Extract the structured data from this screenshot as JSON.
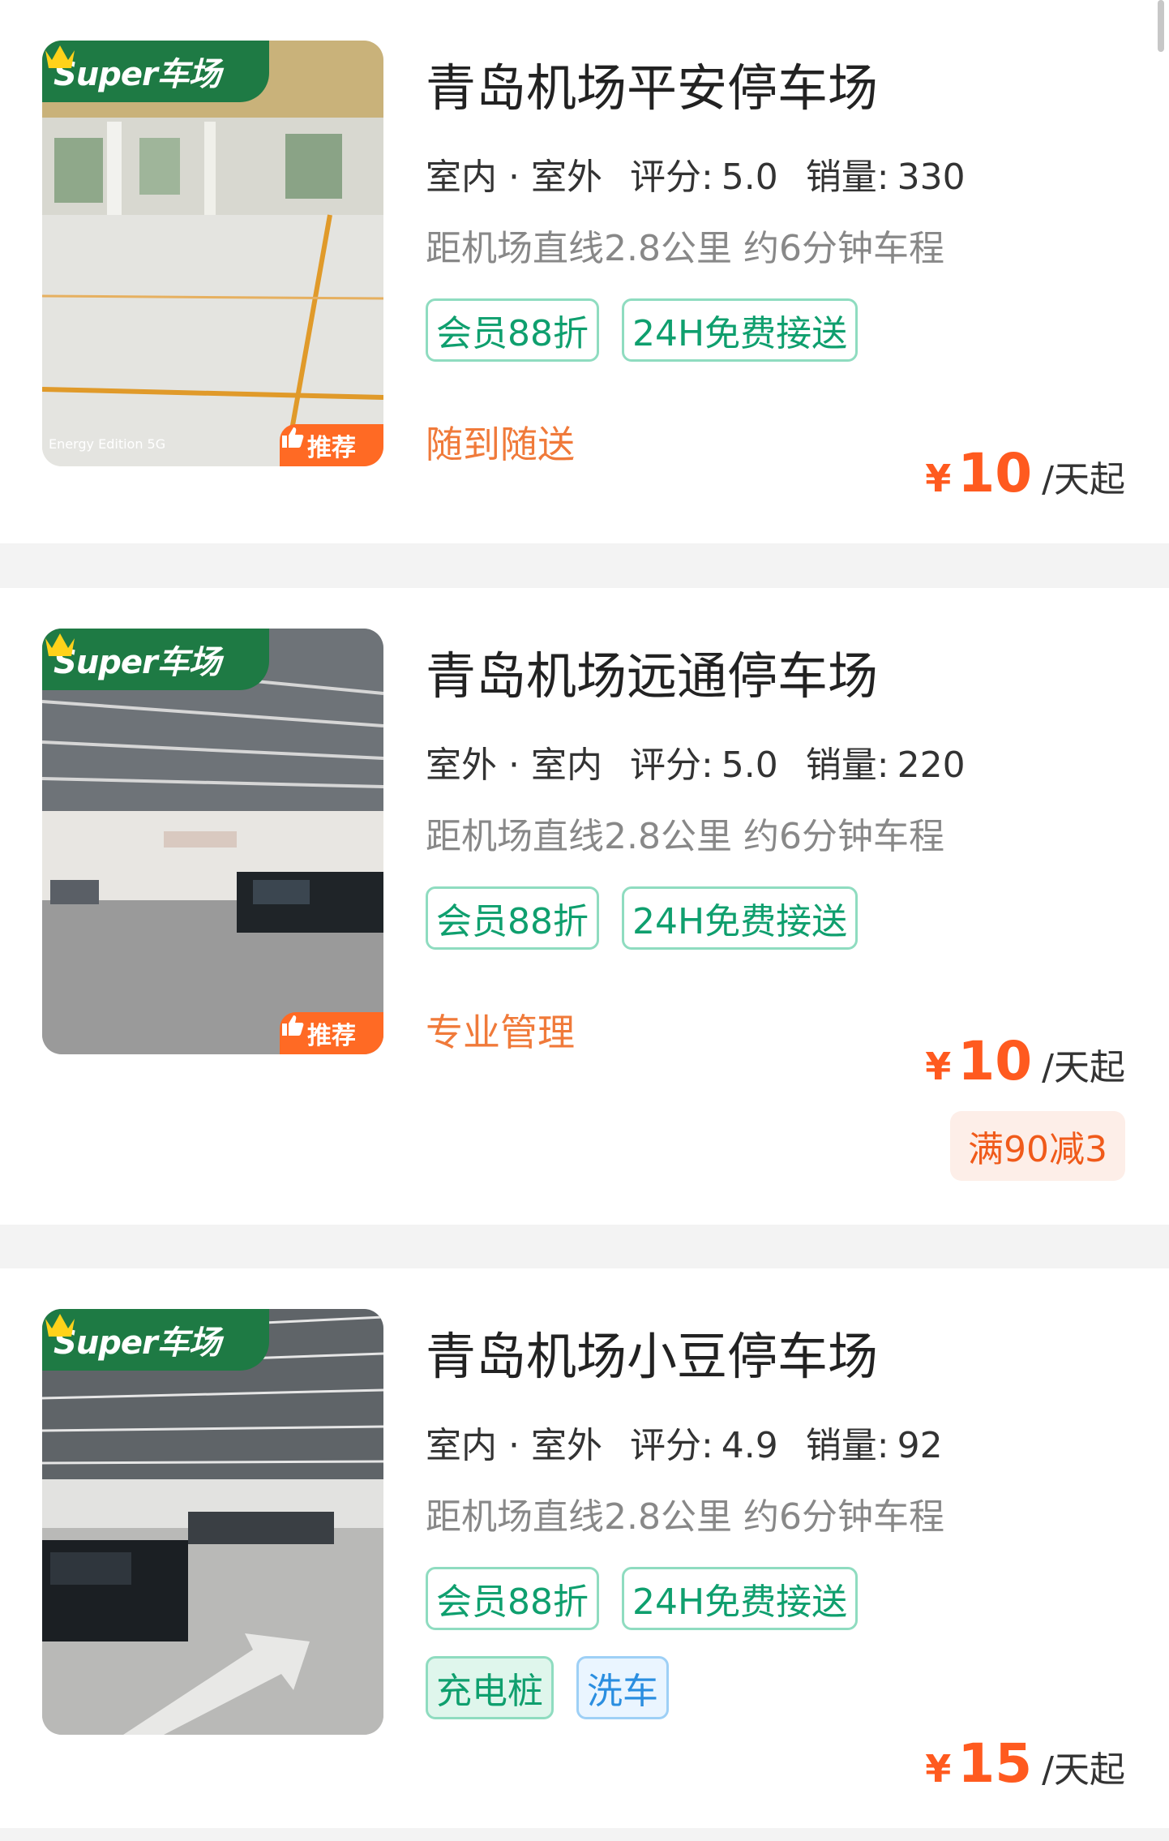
{
  "colors": {
    "accent_green": "#0f9f6e",
    "price_orange": "#ff5a1f",
    "service_orange": "#f07a3a",
    "badge_green": "#1e7a44",
    "recommend_orange": "#ff6a24"
  },
  "listings": [
    {
      "badge": "Super车场",
      "recommend": "推荐",
      "photo_caption": "Energy Edition 5G",
      "title": "青岛机场平安停车场",
      "type": "室内 · 室外",
      "rating_label": "评分:",
      "rating": "5.0",
      "sales_label": "销量:",
      "sales": "330",
      "distance": "距机场直线2.8公里 约6分钟车程",
      "tags": [
        "会员88折",
        "24H免费接送"
      ],
      "service": "随到随送",
      "price_symbol": "¥",
      "price": "10",
      "price_unit": "/天起"
    },
    {
      "badge": "Super车场",
      "recommend": "推荐",
      "title": "青岛机场远通停车场",
      "type": "室外 · 室内",
      "rating_label": "评分:",
      "rating": "5.0",
      "sales_label": "销量:",
      "sales": "220",
      "distance": "距机场直线2.8公里 约6分钟车程",
      "tags": [
        "会员88折",
        "24H免费接送"
      ],
      "service": "专业管理",
      "price_symbol": "¥",
      "price": "10",
      "price_unit": "/天起",
      "promo": "满90减3"
    },
    {
      "badge": "Super车场",
      "title": "青岛机场小豆停车场",
      "type": "室内 · 室外",
      "rating_label": "评分:",
      "rating": "4.9",
      "sales_label": "销量:",
      "sales": "92",
      "distance": "距机场直线2.8公里 约6分钟车程",
      "tags": [
        "会员88折",
        "24H免费接送"
      ],
      "extra_tags": [
        "充电桩",
        "洗车"
      ],
      "price_symbol": "¥",
      "price": "15",
      "price_unit": "/天起"
    }
  ]
}
